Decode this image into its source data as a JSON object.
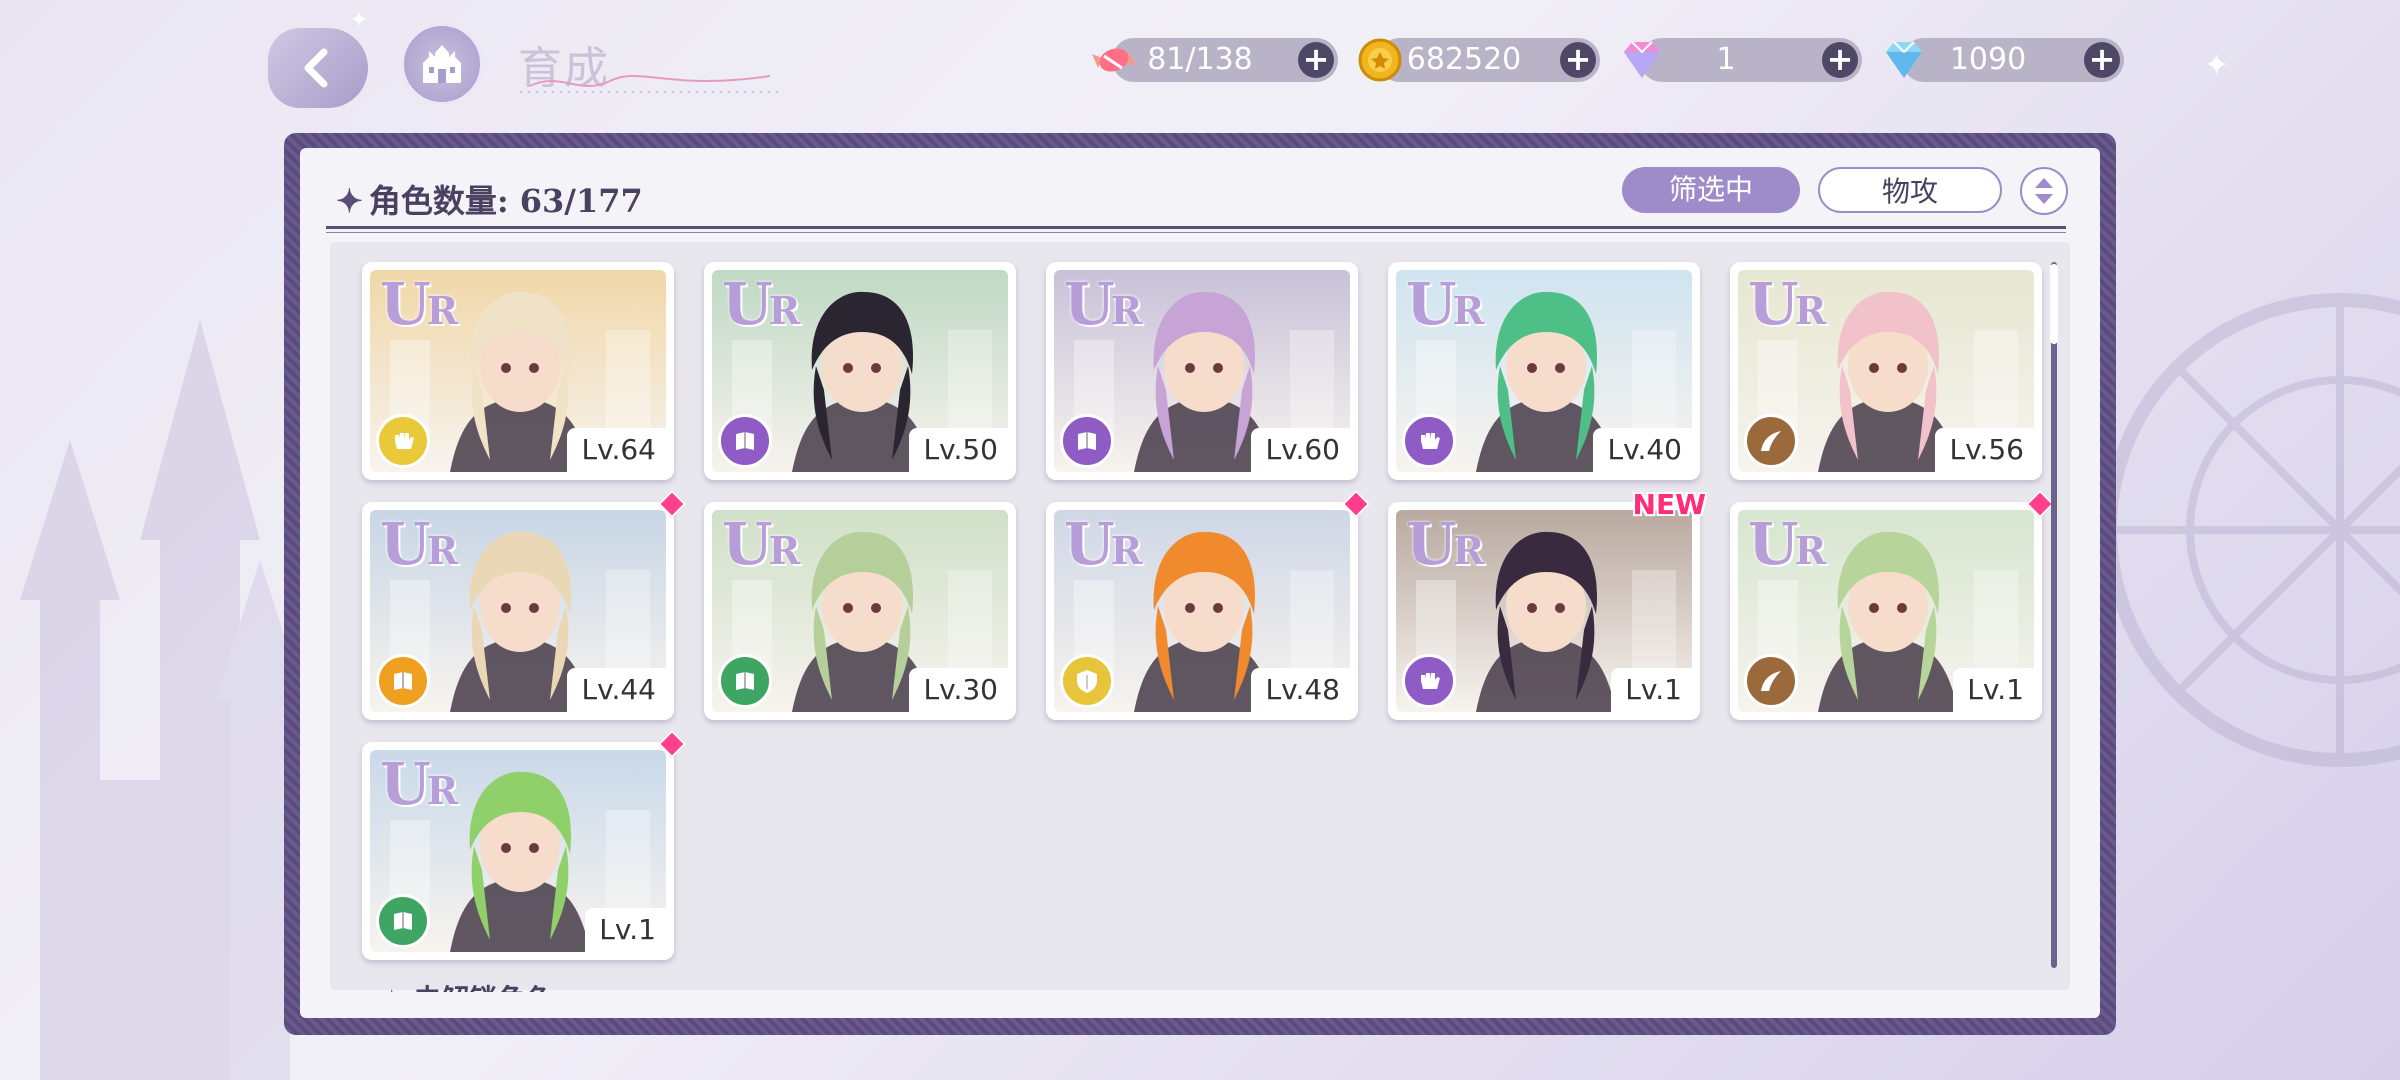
{
  "header": {
    "title": "育成",
    "resources": [
      {
        "name": "candy",
        "value": "81/138",
        "icon": "candy-icon"
      },
      {
        "name": "gold",
        "value": "682520",
        "icon": "gold-coin-icon"
      },
      {
        "name": "pink-gem",
        "value": "1",
        "icon": "pink-gem-icon"
      },
      {
        "name": "blue-diamond",
        "value": "1090",
        "icon": "blue-diamond-icon"
      }
    ]
  },
  "panel": {
    "count_label": "角色数量: 63/177",
    "filter_active": "筛选中",
    "filter_type": "物攻",
    "next_section": "未解锁角色"
  },
  "characters": [
    {
      "rarity": "UR",
      "level": "Lv.64",
      "type_color": "#e9c93a",
      "type_icon": "fist-icon",
      "hair": "#efe2c7",
      "bg": "#f0d7a8",
      "marker": ""
    },
    {
      "rarity": "UR",
      "level": "Lv.50",
      "type_color": "#8e5cc4",
      "type_icon": "book-icon",
      "hair": "#2a2530",
      "bg": "#bfd9c4",
      "marker": ""
    },
    {
      "rarity": "UR",
      "level": "Lv.60",
      "type_color": "#8e5cc4",
      "type_icon": "book-icon",
      "hair": "#c7a3d6",
      "bg": "#c9c1d8",
      "marker": ""
    },
    {
      "rarity": "UR",
      "level": "Lv.40",
      "type_color": "#8e5cc4",
      "type_icon": "fist-icon",
      "hair": "#4fbf88",
      "bg": "#cfe4f0",
      "marker": ""
    },
    {
      "rarity": "UR",
      "level": "Lv.56",
      "type_color": "#9a6a3a",
      "type_icon": "horn-icon",
      "hair": "#f1c2c9",
      "bg": "#e6e7d1",
      "marker": ""
    },
    {
      "rarity": "UR",
      "level": "Lv.44",
      "type_color": "#f0a020",
      "type_icon": "book-icon",
      "hair": "#e9d7b6",
      "bg": "#c8d6e6",
      "marker": "diamond"
    },
    {
      "rarity": "UR",
      "level": "Lv.30",
      "type_color": "#3fa562",
      "type_icon": "book-icon",
      "hair": "#b6cf9a",
      "bg": "#cfe0c8",
      "marker": ""
    },
    {
      "rarity": "UR",
      "level": "Lv.48",
      "type_color": "#e6c53a",
      "type_icon": "shield-icon",
      "hair": "#f08a2c",
      "bg": "#cfd7e6",
      "marker": "diamond"
    },
    {
      "rarity": "UR",
      "level": "Lv.1",
      "type_color": "#8e5cc4",
      "type_icon": "fist-icon",
      "hair": "#3a2a40",
      "bg": "#b9a9a0",
      "marker": "NEW"
    },
    {
      "rarity": "UR",
      "level": "Lv.1",
      "type_color": "#9a6a3a",
      "type_icon": "horn-icon",
      "hair": "#b7d59a",
      "bg": "#d6e6cf",
      "marker": "diamond"
    },
    {
      "rarity": "UR",
      "level": "Lv.1",
      "type_color": "#3fa562",
      "type_icon": "book-icon",
      "hair": "#8fd06a",
      "bg": "#c9d9ea",
      "marker": "diamond"
    }
  ]
}
